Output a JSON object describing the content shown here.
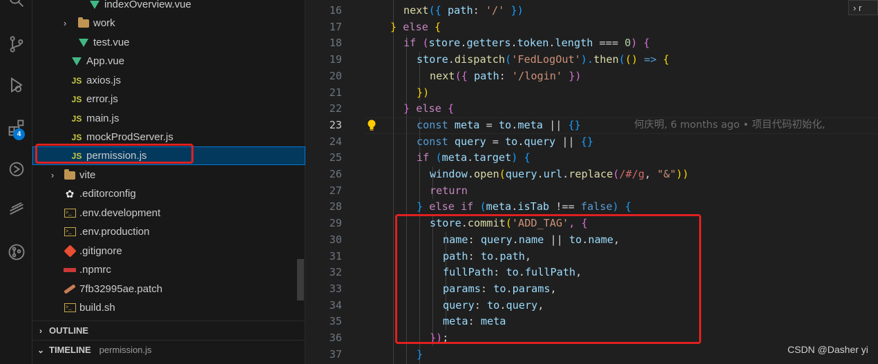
{
  "explorer": {
    "items": [
      {
        "label": "indexOverview.vue",
        "icon": "vue-icon"
      },
      {
        "label": "work",
        "icon": "folder-icon"
      },
      {
        "label": "test.vue",
        "icon": "vue-icon"
      },
      {
        "label": "App.vue",
        "icon": "vue-icon"
      },
      {
        "label": "axios.js",
        "icon": "js-icon"
      },
      {
        "label": "error.js",
        "icon": "js-icon"
      },
      {
        "label": "main.js",
        "icon": "js-icon"
      },
      {
        "label": "mockProdServer.js",
        "icon": "js-icon"
      },
      {
        "label": "permission.js",
        "icon": "js-icon"
      },
      {
        "label": "vite",
        "icon": "folder-icon"
      },
      {
        "label": ".editorconfig",
        "icon": "gear-icon"
      },
      {
        "label": ".env.development",
        "icon": "terminal-icon"
      },
      {
        "label": ".env.production",
        "icon": "terminal-icon"
      },
      {
        "label": ".gitignore",
        "icon": "git-icon"
      },
      {
        "label": ".npmrc",
        "icon": "npm-icon"
      },
      {
        "label": "7fb32995ae.patch",
        "icon": "patch-icon"
      },
      {
        "label": "build.sh",
        "icon": "terminal-icon"
      }
    ],
    "js_glyph": "JS",
    "outline": "OUTLINE",
    "timeline": "TIMELINE",
    "timeline_file": "permission.js"
  },
  "activity": {
    "extensions_badge": "4"
  },
  "editor": {
    "line_numbers": [
      "16",
      "17",
      "18",
      "19",
      "20",
      "21",
      "22",
      "23",
      "24",
      "25",
      "26",
      "27",
      "28",
      "29",
      "30",
      "31",
      "32",
      "33",
      "34",
      "35",
      "36",
      "37"
    ],
    "active_line": "23",
    "blame": "何庆明, 6 months ago • 项目代码初始化,",
    "top_right": "r",
    "tokens": {
      "l16": [
        "next",
        "({ ",
        "path",
        ": ",
        "'/'",
        " })"
      ],
      "l17": [
        "}",
        " else ",
        "{"
      ],
      "l18": [
        "if",
        " (",
        "store",
        ".",
        "getters",
        ".",
        "token",
        ".",
        "length",
        " === ",
        "0",
        ") {"
      ],
      "l19": [
        "store",
        ".",
        "dispatch",
        "(",
        "'FedLogOut'",
        ").",
        "then",
        "(",
        "()",
        " => ",
        "{"
      ],
      "l20": [
        "next",
        "({ ",
        "path",
        ": ",
        "'/login'",
        " })"
      ],
      "l21": [
        "})"
      ],
      "l22": [
        "}",
        " else ",
        "{"
      ],
      "l23": [
        "const",
        " ",
        "meta",
        " = ",
        "to",
        ".",
        "meta",
        " || ",
        "{}"
      ],
      "l24": [
        "const",
        " ",
        "query",
        " = ",
        "to",
        ".",
        "query",
        " || ",
        "{}"
      ],
      "l25": [
        "if",
        " (",
        "meta",
        ".",
        "target",
        ") {"
      ],
      "l26": [
        "window",
        ".",
        "open",
        "(",
        "query",
        ".",
        "url",
        ".",
        "replace",
        "(",
        "/#/g",
        ", ",
        "\"&\"",
        "))"
      ],
      "l27": [
        "return"
      ],
      "l28": [
        "}",
        " else ",
        "if",
        " (",
        "meta",
        ".",
        "isTab",
        " !== ",
        "false",
        ") {"
      ],
      "l29": [
        "store",
        ".",
        "commit",
        "(",
        "'ADD_TAG'",
        ", {"
      ],
      "l30": [
        "name",
        ": ",
        "query",
        ".",
        "name",
        " || ",
        "to",
        ".",
        "name",
        ","
      ],
      "l31": [
        "path",
        ": ",
        "to",
        ".",
        "path",
        ","
      ],
      "l32": [
        "fullPath",
        ": ",
        "to",
        ".",
        "fullPath",
        ","
      ],
      "l33": [
        "params",
        ": ",
        "to",
        ".",
        "params",
        ","
      ],
      "l34": [
        "query",
        ": ",
        "to",
        ".",
        "query",
        ","
      ],
      "l35": [
        "meta",
        ": ",
        "meta"
      ],
      "l36": [
        "})",
        ";"
      ],
      "l37": [
        "}"
      ]
    }
  },
  "watermark": "CSDN @Dasher yi"
}
